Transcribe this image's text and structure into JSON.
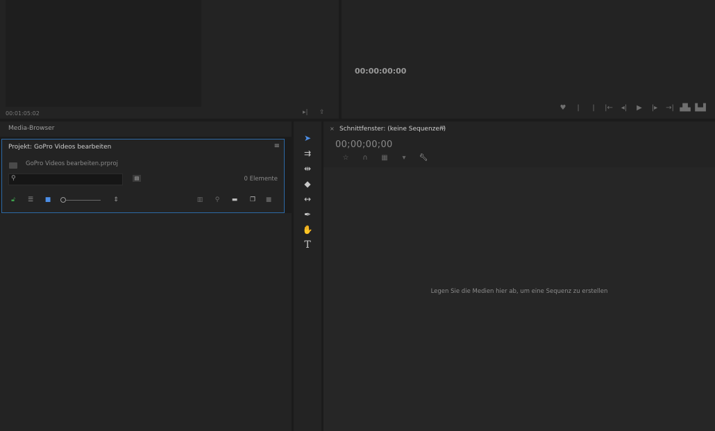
{
  "source_monitor": {
    "timecode": "00:01:05:02"
  },
  "program_monitor": {
    "timecode": "00:00:00:00",
    "controls": [
      "marker-icon",
      "mark-in-icon",
      "mark-out-icon",
      "go-to-in-icon",
      "step-back-icon",
      "play-icon",
      "step-forward-icon",
      "go-to-out-icon",
      "lift-icon",
      "extract-icon"
    ]
  },
  "media_browser": {
    "tab_label": "Media-Browser"
  },
  "project": {
    "title": "Projekt: GoPro Videos bearbeiten",
    "file_name": "GoPro Videos bearbeiten.prproj",
    "search_placeholder": "",
    "item_count": "0 Elemente"
  },
  "tools": [
    "selection-tool-icon",
    "track-select-tool-icon",
    "ripple-edit-tool-icon",
    "razor-tool-icon",
    "slip-tool-icon",
    "pen-tool-icon",
    "hand-tool-icon",
    "type-tool-icon"
  ],
  "timeline": {
    "title": "Schnittfenster: (keine Sequenzen)",
    "timecode": "00;00;00;00",
    "hint": "Legen Sie die Medien hier ab, um eine Sequenz zu erstellen"
  },
  "colors": {
    "accent": "#2d6aa7",
    "selection_tool": "#4c8ee6",
    "lock_green": "#3fa34d"
  }
}
